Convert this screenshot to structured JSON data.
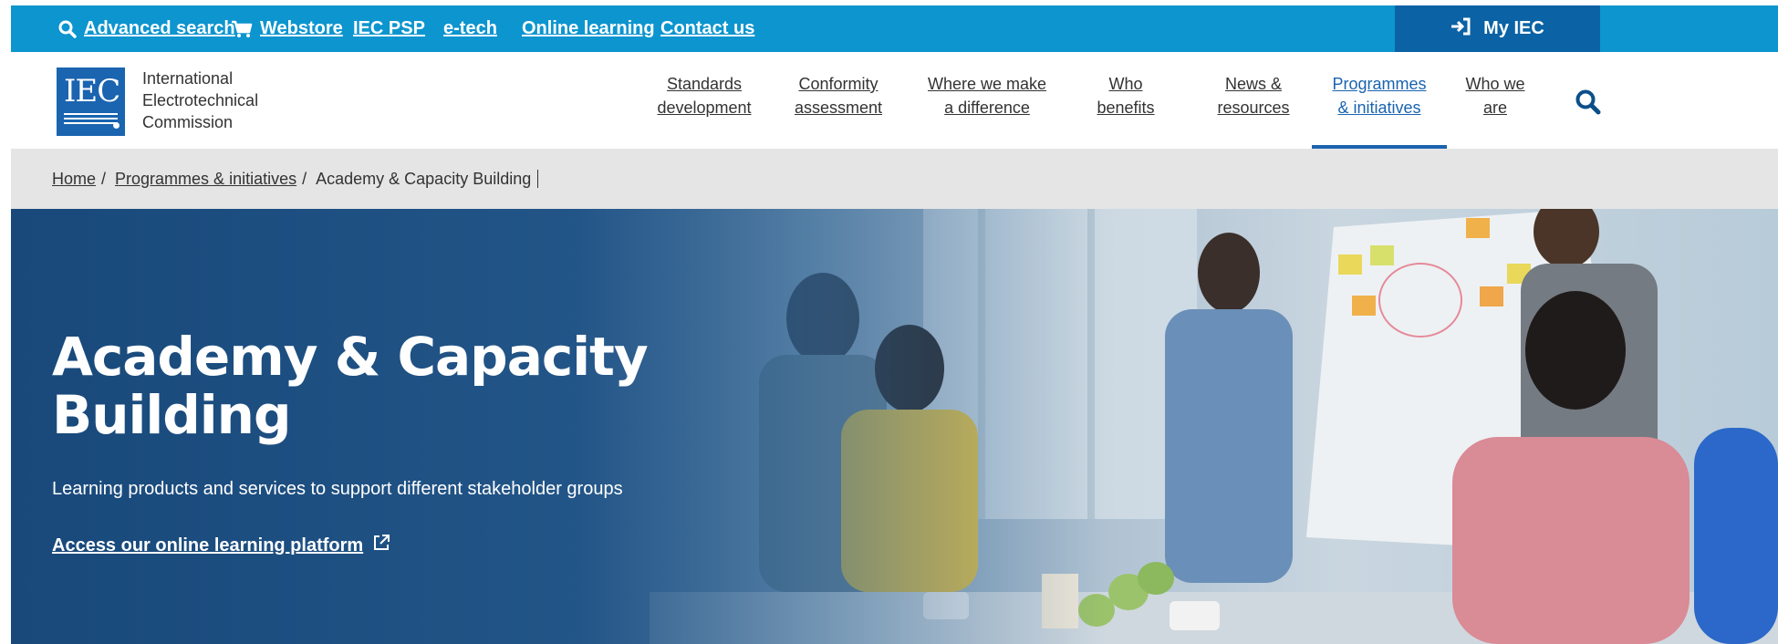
{
  "topbar": {
    "links": [
      {
        "label": "Advanced search",
        "icon": "search-icon"
      },
      {
        "label": "Webstore",
        "icon": "cart-icon"
      },
      {
        "label": "IEC PSP"
      },
      {
        "label": "e-tech"
      },
      {
        "label": "Online learning"
      },
      {
        "label": "Contact us"
      }
    ],
    "my_iec": {
      "label": "My IEC",
      "icon": "sign-in-icon"
    },
    "colors": {
      "bar": "#0d95cf",
      "my_iec": "#0b62a4"
    }
  },
  "header": {
    "logo_text": "IEC",
    "org_name": [
      "International",
      "Electrotechnical",
      "Commission"
    ],
    "nav": [
      {
        "line1": "Standards",
        "line2": "development"
      },
      {
        "line1": "Conformity",
        "line2": "assessment"
      },
      {
        "line1": "Where we make",
        "line2": "a difference"
      },
      {
        "line1": "Who",
        "line2": "benefits"
      },
      {
        "line1": "News &",
        "line2": "resources"
      },
      {
        "line1": "Programmes",
        "line2": "& initiatives",
        "active": true
      },
      {
        "line1": "Who we",
        "line2": "are"
      }
    ],
    "search_icon": "search-icon",
    "accent": "#1a64b0"
  },
  "breadcrumb": {
    "items": [
      "Home",
      "Programmes & initiatives",
      "Academy & Capacity Building"
    ],
    "separator": "/"
  },
  "hero": {
    "title_line1": "Academy & Capacity",
    "title_line2": "Building",
    "subtitle": "Learning products and services to support different stakeholder groups",
    "link_label": "Access our online learning platform",
    "link_icon": "external-link-icon",
    "image_desc_icon": "hero-photo"
  }
}
